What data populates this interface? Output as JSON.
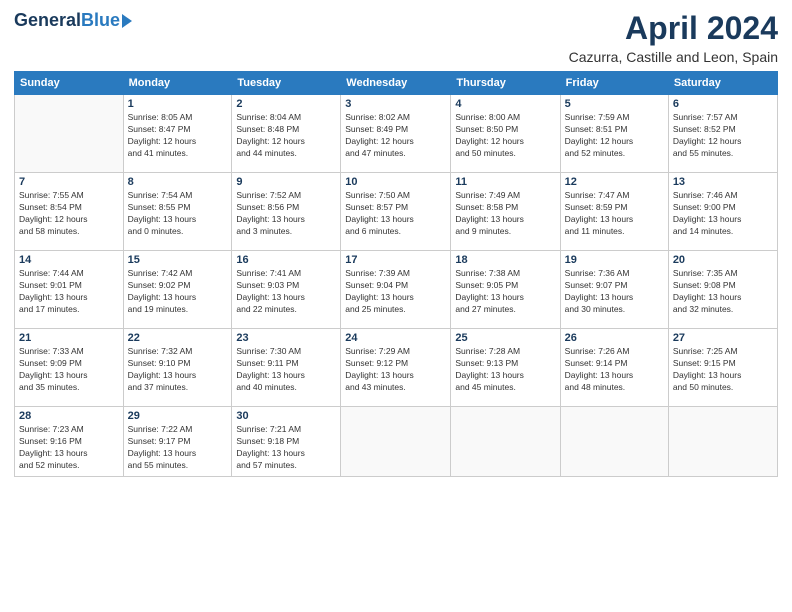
{
  "header": {
    "logo_general": "General",
    "logo_blue": "Blue",
    "title": "April 2024",
    "subtitle": "Cazurra, Castille and Leon, Spain"
  },
  "weekdays": [
    "Sunday",
    "Monday",
    "Tuesday",
    "Wednesday",
    "Thursday",
    "Friday",
    "Saturday"
  ],
  "weeks": [
    [
      {
        "day": "",
        "info": ""
      },
      {
        "day": "1",
        "info": "Sunrise: 8:05 AM\nSunset: 8:47 PM\nDaylight: 12 hours\nand 41 minutes."
      },
      {
        "day": "2",
        "info": "Sunrise: 8:04 AM\nSunset: 8:48 PM\nDaylight: 12 hours\nand 44 minutes."
      },
      {
        "day": "3",
        "info": "Sunrise: 8:02 AM\nSunset: 8:49 PM\nDaylight: 12 hours\nand 47 minutes."
      },
      {
        "day": "4",
        "info": "Sunrise: 8:00 AM\nSunset: 8:50 PM\nDaylight: 12 hours\nand 50 minutes."
      },
      {
        "day": "5",
        "info": "Sunrise: 7:59 AM\nSunset: 8:51 PM\nDaylight: 12 hours\nand 52 minutes."
      },
      {
        "day": "6",
        "info": "Sunrise: 7:57 AM\nSunset: 8:52 PM\nDaylight: 12 hours\nand 55 minutes."
      }
    ],
    [
      {
        "day": "7",
        "info": "Sunrise: 7:55 AM\nSunset: 8:54 PM\nDaylight: 12 hours\nand 58 minutes."
      },
      {
        "day": "8",
        "info": "Sunrise: 7:54 AM\nSunset: 8:55 PM\nDaylight: 13 hours\nand 0 minutes."
      },
      {
        "day": "9",
        "info": "Sunrise: 7:52 AM\nSunset: 8:56 PM\nDaylight: 13 hours\nand 3 minutes."
      },
      {
        "day": "10",
        "info": "Sunrise: 7:50 AM\nSunset: 8:57 PM\nDaylight: 13 hours\nand 6 minutes."
      },
      {
        "day": "11",
        "info": "Sunrise: 7:49 AM\nSunset: 8:58 PM\nDaylight: 13 hours\nand 9 minutes."
      },
      {
        "day": "12",
        "info": "Sunrise: 7:47 AM\nSunset: 8:59 PM\nDaylight: 13 hours\nand 11 minutes."
      },
      {
        "day": "13",
        "info": "Sunrise: 7:46 AM\nSunset: 9:00 PM\nDaylight: 13 hours\nand 14 minutes."
      }
    ],
    [
      {
        "day": "14",
        "info": "Sunrise: 7:44 AM\nSunset: 9:01 PM\nDaylight: 13 hours\nand 17 minutes."
      },
      {
        "day": "15",
        "info": "Sunrise: 7:42 AM\nSunset: 9:02 PM\nDaylight: 13 hours\nand 19 minutes."
      },
      {
        "day": "16",
        "info": "Sunrise: 7:41 AM\nSunset: 9:03 PM\nDaylight: 13 hours\nand 22 minutes."
      },
      {
        "day": "17",
        "info": "Sunrise: 7:39 AM\nSunset: 9:04 PM\nDaylight: 13 hours\nand 25 minutes."
      },
      {
        "day": "18",
        "info": "Sunrise: 7:38 AM\nSunset: 9:05 PM\nDaylight: 13 hours\nand 27 minutes."
      },
      {
        "day": "19",
        "info": "Sunrise: 7:36 AM\nSunset: 9:07 PM\nDaylight: 13 hours\nand 30 minutes."
      },
      {
        "day": "20",
        "info": "Sunrise: 7:35 AM\nSunset: 9:08 PM\nDaylight: 13 hours\nand 32 minutes."
      }
    ],
    [
      {
        "day": "21",
        "info": "Sunrise: 7:33 AM\nSunset: 9:09 PM\nDaylight: 13 hours\nand 35 minutes."
      },
      {
        "day": "22",
        "info": "Sunrise: 7:32 AM\nSunset: 9:10 PM\nDaylight: 13 hours\nand 37 minutes."
      },
      {
        "day": "23",
        "info": "Sunrise: 7:30 AM\nSunset: 9:11 PM\nDaylight: 13 hours\nand 40 minutes."
      },
      {
        "day": "24",
        "info": "Sunrise: 7:29 AM\nSunset: 9:12 PM\nDaylight: 13 hours\nand 43 minutes."
      },
      {
        "day": "25",
        "info": "Sunrise: 7:28 AM\nSunset: 9:13 PM\nDaylight: 13 hours\nand 45 minutes."
      },
      {
        "day": "26",
        "info": "Sunrise: 7:26 AM\nSunset: 9:14 PM\nDaylight: 13 hours\nand 48 minutes."
      },
      {
        "day": "27",
        "info": "Sunrise: 7:25 AM\nSunset: 9:15 PM\nDaylight: 13 hours\nand 50 minutes."
      }
    ],
    [
      {
        "day": "28",
        "info": "Sunrise: 7:23 AM\nSunset: 9:16 PM\nDaylight: 13 hours\nand 52 minutes."
      },
      {
        "day": "29",
        "info": "Sunrise: 7:22 AM\nSunset: 9:17 PM\nDaylight: 13 hours\nand 55 minutes."
      },
      {
        "day": "30",
        "info": "Sunrise: 7:21 AM\nSunset: 9:18 PM\nDaylight: 13 hours\nand 57 minutes."
      },
      {
        "day": "",
        "info": ""
      },
      {
        "day": "",
        "info": ""
      },
      {
        "day": "",
        "info": ""
      },
      {
        "day": "",
        "info": ""
      }
    ]
  ]
}
